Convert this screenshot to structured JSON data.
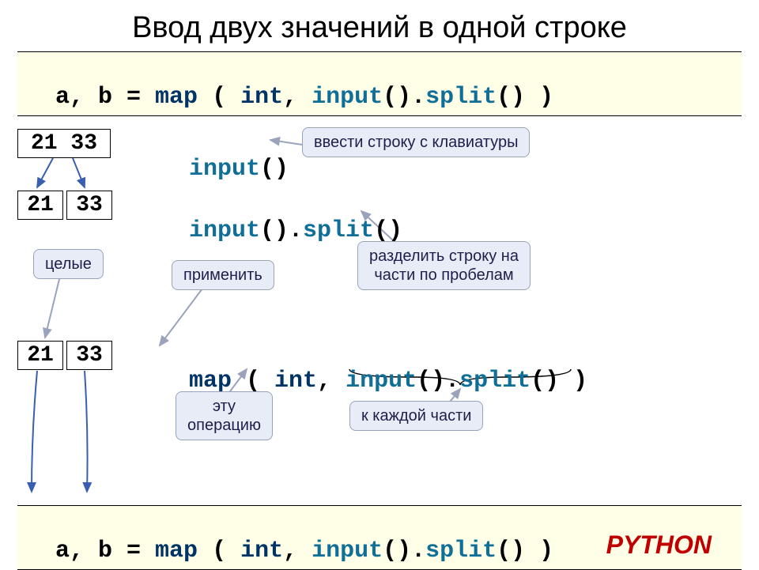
{
  "title": "Ввод двух значений в одной строке",
  "codebar_top": {
    "seg1": "a, b = ",
    "seg2": "map",
    "seg3": " ( ",
    "seg4": "int",
    "seg5": ", ",
    "seg6": "input",
    "seg7": "().",
    "seg8": "split",
    "seg9": "() )"
  },
  "row1": {
    "box": "21 33",
    "code_a": "input",
    "code_b": "()",
    "callout": "ввести строку с клавиатуры"
  },
  "row2": {
    "box_a": "21",
    "box_b": "33",
    "code_a": "input",
    "code_b": "().",
    "code_c": "split",
    "code_d": "()"
  },
  "callouts_mid": {
    "whole": "целые",
    "apply": "применить",
    "split_desc": "разделить строку на\nчасти по пробелам"
  },
  "row3": {
    "box_a": "21",
    "box_b": "33",
    "seg1": "map",
    "seg2": " ( ",
    "seg3": "int",
    "seg4": ", ",
    "seg5": "input",
    "seg6": "().",
    "seg7": "split",
    "seg8": "() )"
  },
  "callouts_low": {
    "this_op": "эту\nоперацию",
    "each_part": "к каждой части"
  },
  "codebar_bottom": {
    "seg1": "a, b = ",
    "seg2": "map",
    "seg3": " ( ",
    "seg4": "int",
    "seg5": ", ",
    "seg6": "input",
    "seg7": "().",
    "seg8": "split",
    "seg9": "() )"
  },
  "lang": "PYTHON"
}
